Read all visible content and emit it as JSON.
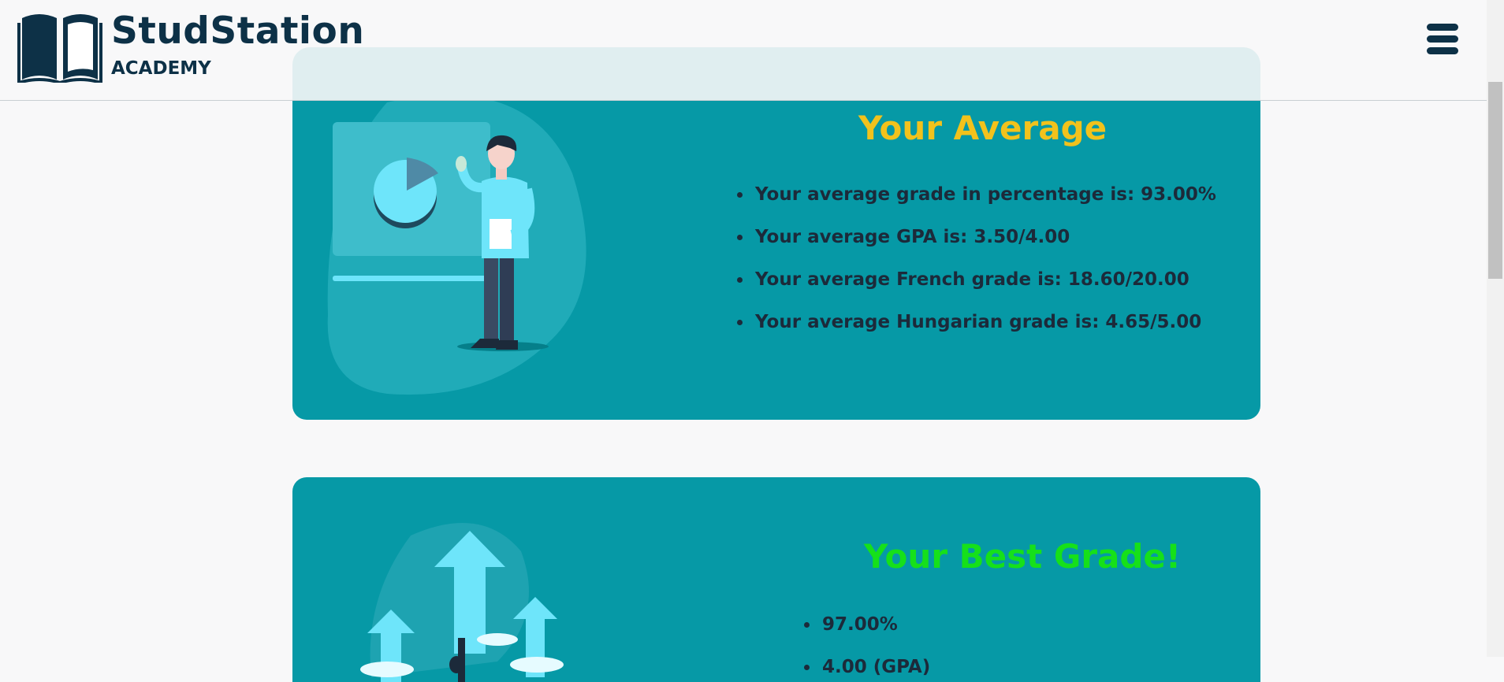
{
  "header": {
    "brand_title": "StudStation",
    "brand_subtitle": "ACADEMY",
    "menu_icon": "hamburger-menu-icon",
    "brand_color": "#0d3147"
  },
  "average_card": {
    "title": "Your Average",
    "title_color": "#f2c21c",
    "items": [
      "Your average grade in percentage is: 93.00%",
      "Your average GPA is: 3.50/4.00",
      "Your average French grade is: 18.60/20.00",
      "Your average Hungarian grade is: 4.65/5.00"
    ]
  },
  "best_card": {
    "title": "Your Best Grade!",
    "title_color": "#16e01a",
    "items": [
      "97.00%",
      "4.00 (GPA)"
    ]
  },
  "colors": {
    "card_bg": "#0699a6",
    "text_dark": "#1c2a3a",
    "page_bg": "#f8f8f9"
  }
}
